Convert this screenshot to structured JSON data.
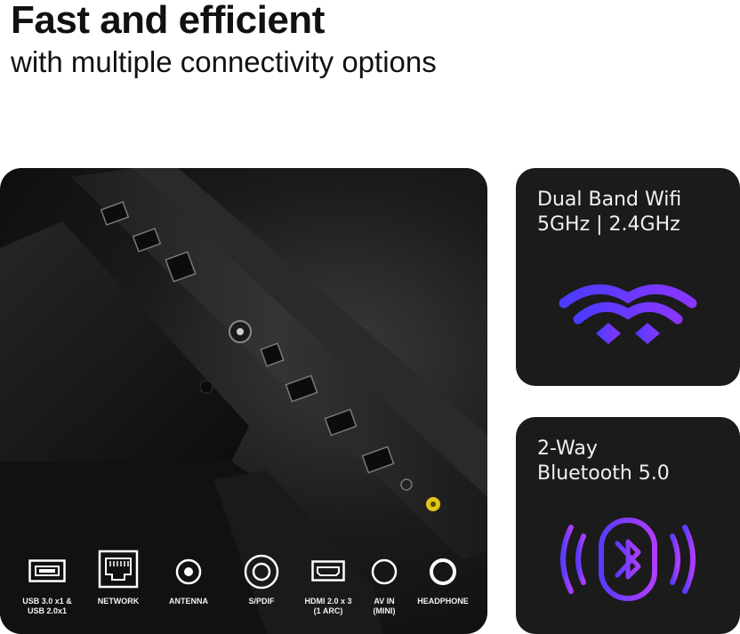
{
  "header": {
    "title": "Fast and efficient",
    "subtitle": "with multiple connectivity options"
  },
  "ports": [
    {
      "label": "USB 3.0 x1 &\nUSB 2.0x1",
      "icon": "usb-icon"
    },
    {
      "label": "NETWORK",
      "icon": "ethernet-icon"
    },
    {
      "label": "ANTENNA",
      "icon": "antenna-icon"
    },
    {
      "label": "S/PDIF",
      "icon": "spdif-icon"
    },
    {
      "label": "HDMI 2.0 x 3\n(1 ARC)",
      "icon": "hdmi-icon"
    },
    {
      "label": "AV IN\n(MINI)",
      "icon": "av-in-icon"
    },
    {
      "label": "HEADPHONE",
      "icon": "headphone-icon"
    }
  ],
  "features": {
    "wifi": {
      "line1": "Dual Band Wifi",
      "line2": "5GHz | 2.4GHz",
      "icon": "wifi-icon"
    },
    "bluetooth": {
      "line1": "2-Way",
      "line2": "Bluetooth 5.0",
      "icon": "bluetooth-icon"
    }
  },
  "colors": {
    "wifi_gradient_start": "#4b3bff",
    "wifi_gradient_end": "#8a36ff",
    "bluetooth_gradient_start": "#5a3bff",
    "bluetooth_gradient_end": "#b03cff",
    "card_background": "#1b1b1b",
    "av_port_accent": "#e3c617"
  }
}
